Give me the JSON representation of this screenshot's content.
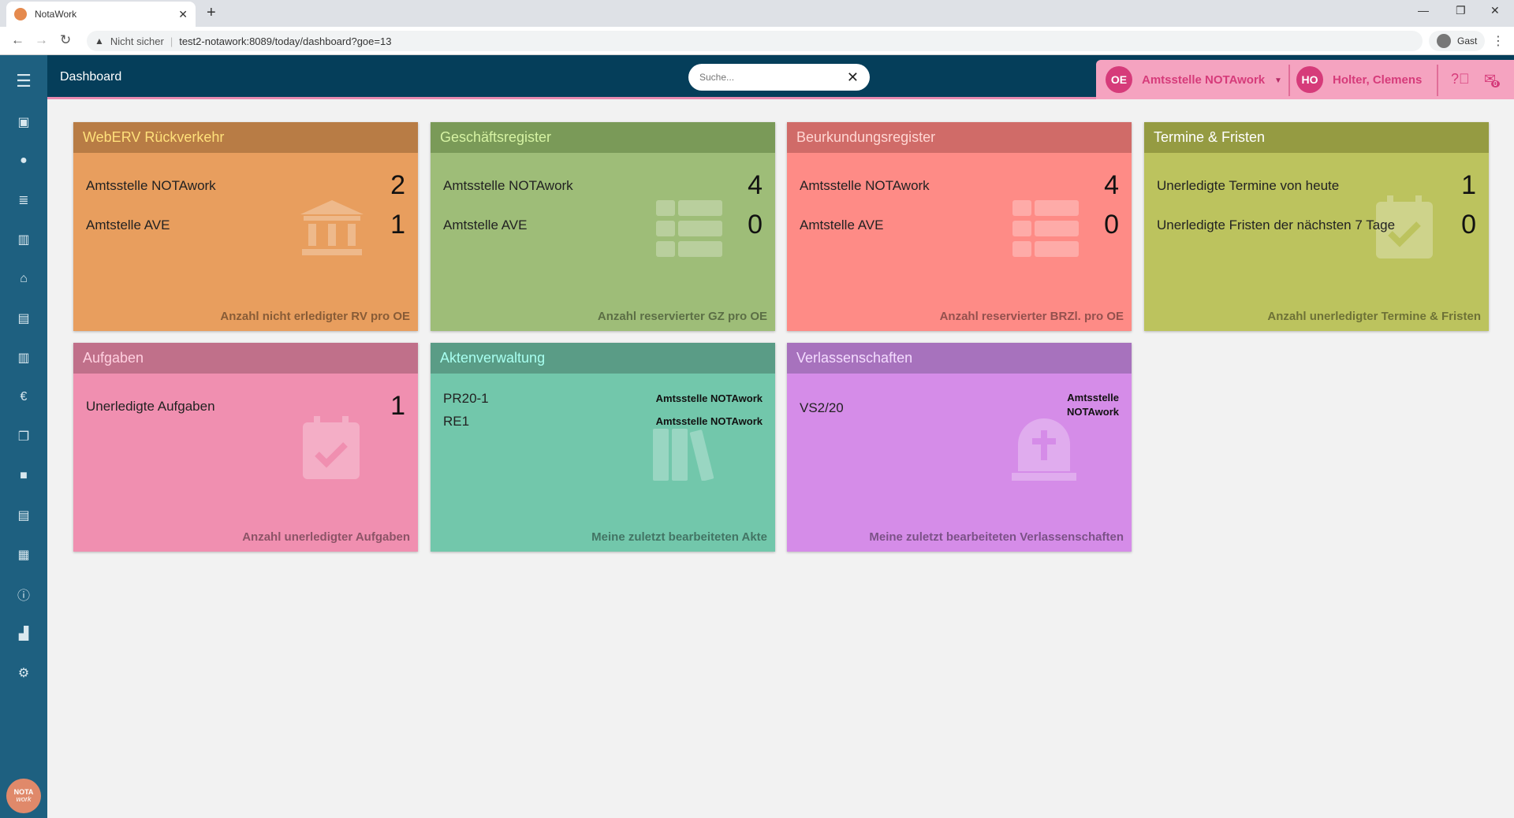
{
  "browser": {
    "tab_title": "NotaWork",
    "url": "test2-notawork:8089/today/dashboard?goe=13",
    "security_label": "Nicht sicher",
    "guest_label": "Gast"
  },
  "header": {
    "title": "Dashboard",
    "search_placeholder": "Suche...",
    "org_badge": "OE",
    "org_name": "Amtsstelle NOTAwork",
    "user_badge": "HO",
    "user_name": "Holter, Clemens",
    "mail_count": "0"
  },
  "sidebar": {
    "icons": [
      "menu-icon",
      "calendar-icon",
      "person-icon",
      "list-icon",
      "books-icon",
      "bank-icon",
      "document-icon",
      "institution-icon",
      "euro-icon",
      "copy-icon",
      "square-icon",
      "file-icon",
      "register-icon",
      "info-icon",
      "chart-icon",
      "gear-icon"
    ],
    "logo_top": "NOTA",
    "logo_bottom": "work"
  },
  "cards": [
    {
      "title": "WebERV Rückverkehr",
      "rows": [
        {
          "label": "Amtsstelle NOTAwork",
          "value": "2"
        },
        {
          "label": "Amtstelle AVE",
          "value": "1"
        }
      ],
      "footer": "Anzahl nicht erledigter RV pro OE"
    },
    {
      "title": "Geschäftsregister",
      "rows": [
        {
          "label": "Amtsstelle NOTAwork",
          "value": "4"
        },
        {
          "label": "Amtstelle AVE",
          "value": "0"
        }
      ],
      "footer": "Anzahl reservierter GZ pro OE"
    },
    {
      "title": "Beurkundungsregister",
      "rows": [
        {
          "label": "Amtsstelle NOTAwork",
          "value": "4"
        },
        {
          "label": "Amtstelle AVE",
          "value": "0"
        }
      ],
      "footer": "Anzahl reservierter BRZl. pro OE"
    },
    {
      "title": "Termine & Fristen",
      "rows": [
        {
          "label": "Unerledigte Termine von heute",
          "value": "1"
        },
        {
          "label": "Unerledigte Fristen der nächsten 7 Tage",
          "value": "0"
        }
      ],
      "footer": "Anzahl unerledigter Termine & Fristen"
    },
    {
      "title": "Aufgaben",
      "rows": [
        {
          "label": "Unerledigte Aufgaben",
          "value": "1"
        }
      ],
      "footer": "Anzahl unerledigter Aufgaben"
    },
    {
      "title": "Aktenverwaltung",
      "rows": [
        {
          "label": "PR20-1",
          "value": "Amtsstelle NOTAwork"
        },
        {
          "label": "RE1",
          "value": "Amtsstelle NOTAwork"
        }
      ],
      "footer": "Meine zuletzt bearbeiteten Akte"
    },
    {
      "title": "Verlassenschaften",
      "rows": [
        {
          "label": "VS2/20",
          "value": "Amtsstelle NOTAwork"
        }
      ],
      "footer": "Meine zuletzt bearbeiteten Verlassenschaften"
    }
  ],
  "colors": {
    "header_bg": "#053e5a",
    "sidebar_bg": "#1e6080",
    "accent_pink": "#d63b7a"
  }
}
